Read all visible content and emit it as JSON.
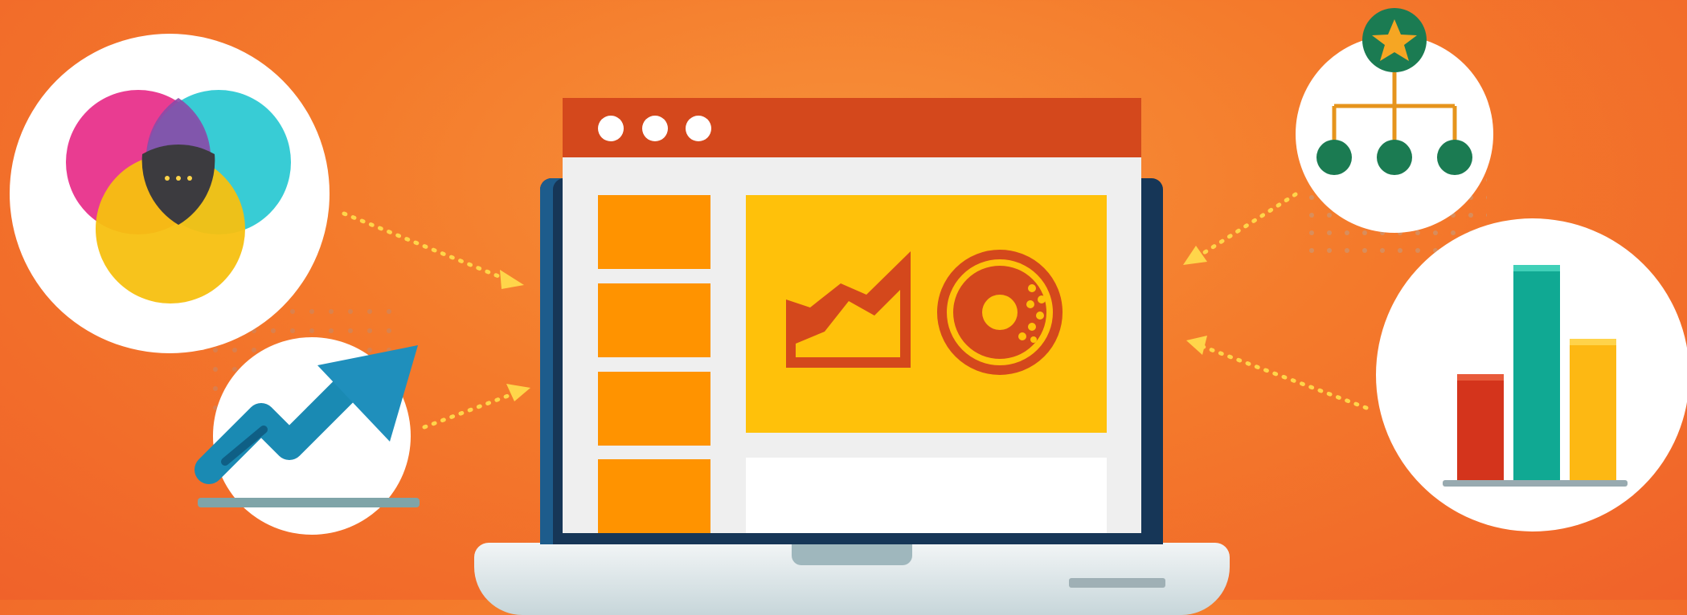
{
  "window": {
    "title_dots": [
      "dot-1",
      "dot-2",
      "dot-3"
    ]
  },
  "icons": [
    "venn-diagram-icon",
    "trend-arrow-icon",
    "area-chart-icon",
    "donut-chart-icon",
    "org-chart-icon",
    "bar-chart-icon",
    "star-icon"
  ],
  "colors": {
    "background": "#f47a2b",
    "titlebar": "#d4481c",
    "panel_yellow": "#ffc10a",
    "block_orange": "#ff9300",
    "bezel": "#163657",
    "dotted_arrow": "#ffd54a"
  }
}
